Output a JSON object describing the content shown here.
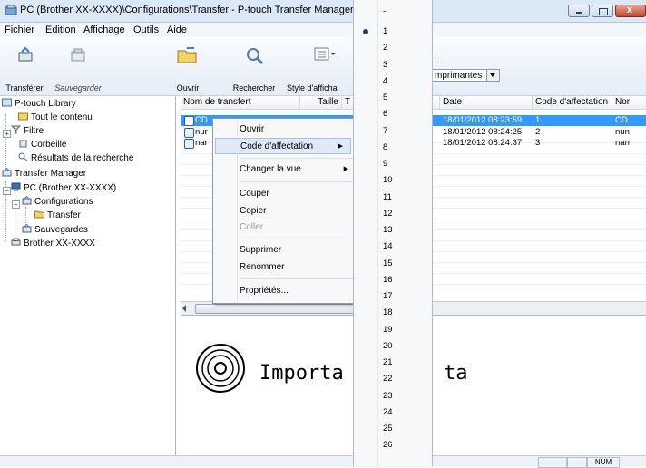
{
  "window": {
    "title": "PC (Brother XX-XXXX)\\Configurations\\Transfer - P-touch Transfer Manager"
  },
  "menubar": [
    "Fichier",
    "Edition",
    "Affichage",
    "Outils",
    "Aide"
  ],
  "toolbar": {
    "transferer": "Transférer",
    "sauvegarder": "Sauvegarder",
    "ouvrir": "Ouvrir",
    "rechercher": "Rechercher",
    "style": "Style d'afficha",
    "printer_label": ":",
    "printer_value": "mprimantes"
  },
  "tree": [
    "P-touch Library",
    "Tout le contenu",
    "Filtre",
    "Corbeille",
    "Résultats de la recherche",
    "Transfer Manager",
    "PC (Brother XX-XXXX)",
    "Configurations",
    "Transfer",
    "Sauvegardes",
    "Brother XX-XXXX"
  ],
  "list": {
    "columns": [
      "Nom de transfert",
      "Taille",
      "T",
      "Date",
      "Code d'affectation",
      "Nor"
    ],
    "rows": [
      {
        "name": "CD",
        "date": "18/01/2012 08:23:59",
        "code": "1",
        "nom": "CD."
      },
      {
        "name": "nur",
        "date": "18/01/2012 08:24:25",
        "code": "2",
        "nom": "nun"
      },
      {
        "name": "nar",
        "date": "18/01/2012 08:24:37",
        "code": "3",
        "nom": "nan"
      }
    ]
  },
  "context_menu": {
    "items": [
      "Ouvrir",
      "Code d'affectation",
      "Changer la vue",
      "Couper",
      "Copier",
      "Coller",
      "Supprimer",
      "Renommer",
      "Propriétés..."
    ]
  },
  "submenu": {
    "top": "-",
    "numbers": [
      "1",
      "2",
      "3",
      "4",
      "5",
      "6",
      "7",
      "8",
      "9",
      "10",
      "11",
      "12",
      "13",
      "14",
      "15",
      "16",
      "17",
      "18",
      "19",
      "20",
      "21",
      "22",
      "23",
      "24",
      "25",
      "26"
    ]
  },
  "preview": {
    "text_left": "Importa",
    "text_right": "ta"
  },
  "statusbar": {
    "num": "NUM"
  },
  "colors": {
    "selection": "#3399ff",
    "menu_highlight": "#dfe9f7"
  }
}
